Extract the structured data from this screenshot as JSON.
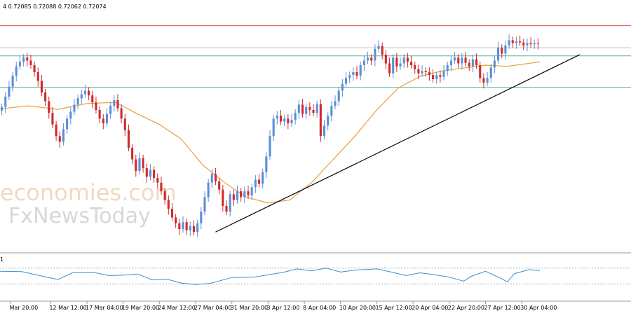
{
  "chart_data": {
    "type": "candlestick",
    "header_text": "4 0.72085 0.72088 0.72062 0.72074",
    "indicator_label": "1",
    "xlim": [
      0,
      149
    ],
    "ylim_price": [
      0.695,
      0.735
    ],
    "ylim_indicator": [
      0,
      100
    ],
    "time_axis_labels": [
      {
        "label": "Mar 20:00",
        "bar": 3
      },
      {
        "label": "12 Mar 12:00",
        "bar": 14
      },
      {
        "label": "17 Mar 04:00",
        "bar": 24
      },
      {
        "label": "19 Mar 20:00",
        "bar": 34
      },
      {
        "label": "24 Mar 12:00",
        "bar": 44
      },
      {
        "label": "27 Mar 04:00",
        "bar": 54
      },
      {
        "label": "31 Mar 20:00",
        "bar": 64
      },
      {
        "label": "3 Apr 12:00",
        "bar": 74
      },
      {
        "label": "8 Apr 04:00",
        "bar": 84
      },
      {
        "label": "10 Apr 20:00",
        "bar": 94
      },
      {
        "label": "15 Apr 12:00",
        "bar": 104
      },
      {
        "label": "20 Apr 04:00",
        "bar": 114
      },
      {
        "label": "22 Apr 20:00",
        "bar": 124
      },
      {
        "label": "27 Apr 12:00",
        "bar": 134
      },
      {
        "label": "30 Apr 04:00",
        "bar": 144
      }
    ],
    "horizontal_levels": [
      {
        "price": 0.733,
        "color": "#d9534f"
      },
      {
        "price": 0.7292,
        "color": "#c0c0c0"
      },
      {
        "price": 0.7278,
        "color": "#5fb38a"
      },
      {
        "price": 0.7224,
        "color": "#5fb38a"
      }
    ],
    "trendline": {
      "from": {
        "bar": 59.5,
        "price": 0.6975
      },
      "to": {
        "bar": 160,
        "price": 0.728
      },
      "color": "#000000"
    },
    "moving_average": {
      "color": "#e8a040",
      "points": [
        [
          0,
          0.7187
        ],
        [
          8,
          0.7192
        ],
        [
          16,
          0.7186
        ],
        [
          24,
          0.7196
        ],
        [
          32,
          0.7198
        ],
        [
          38,
          0.7178
        ],
        [
          44,
          0.716
        ],
        [
          50,
          0.7135
        ],
        [
          56,
          0.709
        ],
        [
          62,
          0.706
        ],
        [
          68,
          0.7035
        ],
        [
          74,
          0.7025
        ],
        [
          80,
          0.703
        ],
        [
          86,
          0.706
        ],
        [
          92,
          0.71
        ],
        [
          98,
          0.714
        ],
        [
          104,
          0.7185
        ],
        [
          110,
          0.7223
        ],
        [
          116,
          0.7243
        ],
        [
          122,
          0.7252
        ],
        [
          128,
          0.7257
        ],
        [
          134,
          0.7262
        ],
        [
          140,
          0.726
        ],
        [
          146,
          0.7265
        ],
        [
          149,
          0.7268
        ]
      ]
    },
    "candles": {
      "bars": 149,
      "closes": [
        0.719,
        0.7208,
        0.7225,
        0.7244,
        0.726,
        0.7268,
        0.7275,
        0.727,
        0.7262,
        0.725,
        0.7235,
        0.7215,
        0.72,
        0.718,
        0.716,
        0.714,
        0.713,
        0.7152,
        0.717,
        0.7182,
        0.7194,
        0.7205,
        0.7212,
        0.7218,
        0.721,
        0.7198,
        0.7185,
        0.717,
        0.7162,
        0.7178,
        0.7192,
        0.7202,
        0.7188,
        0.717,
        0.715,
        0.712,
        0.71,
        0.708,
        0.7102,
        0.7085,
        0.707,
        0.7082,
        0.7068,
        0.706,
        0.7045,
        0.703,
        0.7015,
        0.7,
        0.699,
        0.698,
        0.6992,
        0.6978,
        0.6985,
        0.6975,
        0.699,
        0.701,
        0.7035,
        0.706,
        0.7075,
        0.7062,
        0.7048,
        0.702,
        0.701,
        0.704,
        0.703,
        0.7045,
        0.7035,
        0.7045,
        0.7038,
        0.7052,
        0.7065,
        0.7058,
        0.7078,
        0.7105,
        0.714,
        0.717,
        0.7175,
        0.7165,
        0.717,
        0.7162,
        0.7168,
        0.718,
        0.7194,
        0.7178,
        0.719,
        0.7185,
        0.718,
        0.7195,
        0.714,
        0.7158,
        0.7175,
        0.7192,
        0.72,
        0.7218,
        0.723,
        0.724,
        0.7245,
        0.725,
        0.7244,
        0.7262,
        0.727,
        0.7275,
        0.727,
        0.729,
        0.7295,
        0.728,
        0.7265,
        0.7248,
        0.7275,
        0.726,
        0.7265,
        0.7275,
        0.7268,
        0.7262,
        0.7255,
        0.7248,
        0.7252,
        0.725,
        0.7245,
        0.7238,
        0.7245,
        0.7242,
        0.7252,
        0.7262,
        0.727,
        0.7275,
        0.7265,
        0.7275,
        0.7266,
        0.726,
        0.7272,
        0.7262,
        0.724,
        0.7232,
        0.724,
        0.7258,
        0.727,
        0.7292,
        0.7282,
        0.7296,
        0.7305,
        0.73,
        0.7303,
        0.7301,
        0.7296,
        0.73,
        0.7298,
        0.73,
        0.7299
      ],
      "bull_color": "#5b8fd8",
      "bear_color": "#d12a2a"
    },
    "indicator_series": [
      [
        0,
        62
      ],
      [
        6,
        61
      ],
      [
        12,
        49
      ],
      [
        16,
        41
      ],
      [
        20,
        58
      ],
      [
        26,
        59
      ],
      [
        30,
        51
      ],
      [
        34,
        52
      ],
      [
        38,
        55
      ],
      [
        42,
        40
      ],
      [
        46,
        42
      ],
      [
        50,
        32
      ],
      [
        54,
        28
      ],
      [
        58,
        31
      ],
      [
        64,
        46
      ],
      [
        70,
        47
      ],
      [
        74,
        53
      ],
      [
        78,
        59
      ],
      [
        82,
        68
      ],
      [
        86,
        63
      ],
      [
        90,
        70
      ],
      [
        94,
        60
      ],
      [
        98,
        65
      ],
      [
        104,
        68
      ],
      [
        108,
        60
      ],
      [
        112,
        51
      ],
      [
        116,
        58
      ],
      [
        120,
        53
      ],
      [
        124,
        47
      ],
      [
        128,
        37
      ],
      [
        130,
        49
      ],
      [
        134,
        62
      ],
      [
        138,
        45
      ],
      [
        140,
        35
      ],
      [
        142,
        56
      ],
      [
        146,
        66
      ],
      [
        149,
        64
      ]
    ],
    "indicator_levels": [
      70,
      30
    ]
  },
  "watermark": {
    "line1": "economies.com",
    "line2": "FxNewsToday"
  }
}
